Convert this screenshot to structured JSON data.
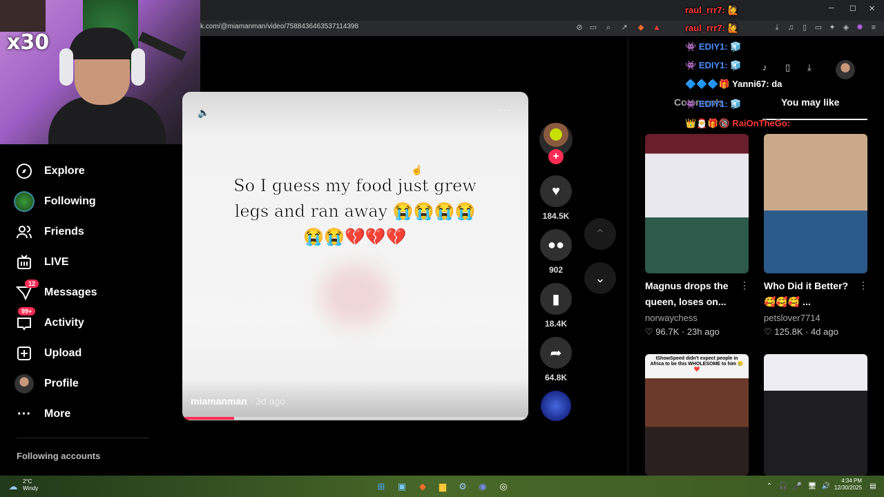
{
  "browser": {
    "url": "k.com/@miamanman/video/7588436463537114398"
  },
  "webcam": {
    "multiplier": "x30"
  },
  "sidebar": {
    "items": [
      {
        "label": "Explore",
        "icon": "compass-icon"
      },
      {
        "label": "Following",
        "icon": "following-avatar-icon"
      },
      {
        "label": "Friends",
        "icon": "friends-icon"
      },
      {
        "label": "LIVE",
        "icon": "live-tv-icon"
      },
      {
        "label": "Messages",
        "icon": "messages-icon",
        "badge": "12"
      },
      {
        "label": "Activity",
        "icon": "activity-icon",
        "badge": "99+"
      },
      {
        "label": "Upload",
        "icon": "upload-icon"
      },
      {
        "label": "Profile",
        "icon": "profile-avatar-icon"
      },
      {
        "label": "More",
        "icon": "more-dots-icon"
      }
    ],
    "following_accounts": "Following accounts"
  },
  "video": {
    "caption_line1": "So I guess my food just grew",
    "caption_line2": "legs and ran away 😭😭😭😭",
    "caption_line3": "😭😭💔💔💔",
    "author": "miamanman",
    "ago": " · 3d ago",
    "progress": 0.15
  },
  "actions": {
    "likes": "184.5K",
    "comments": "902",
    "saves": "18.4K",
    "shares": "64.8K"
  },
  "right_panel": {
    "tab_comments": "Comments",
    "tab_you_may_like": "You may like",
    "cards": [
      {
        "title_line1": "Magnus drops the",
        "title_line2": "queen, loses on...",
        "user": "norwaychess",
        "likes": "96.7K",
        "ago": "23h ago"
      },
      {
        "title_line1": "Who Did it Better?",
        "title_line2": "🥰🥰🥰 ...",
        "user": "petslover7714",
        "likes": "125.8K",
        "ago": "4d ago"
      }
    ],
    "card3_caption": "IShowSpeed didn't expect people in Africa to be this WHOLESOME to him 🥲❤️"
  },
  "chat": [
    {
      "user": "raul_rrr7:",
      "msg": "",
      "color": "#ff3a3a"
    },
    {
      "user": "raul_rrr7:",
      "msg": "",
      "color": "#ff3a3a"
    },
    {
      "user": "EDIY1:",
      "msg": "",
      "color": "#4a8cff"
    },
    {
      "user": "EDIY1:",
      "msg": "",
      "color": "#4a8cff"
    },
    {
      "user": "Yanni67:",
      "msg": "da",
      "color": "#ffffff"
    },
    {
      "user": "EDIY1:",
      "msg": "",
      "color": "#4a8cff"
    },
    {
      "user": "RaiOnTheGo:",
      "msg": "",
      "color": "#ff3a3a"
    }
  ],
  "taskbar": {
    "temp": "2°C",
    "weather": "Windy",
    "time": "4:34 PM",
    "date": "12/30/2025"
  },
  "colors": {
    "accent": "#fe2c55",
    "background": "#000000"
  }
}
